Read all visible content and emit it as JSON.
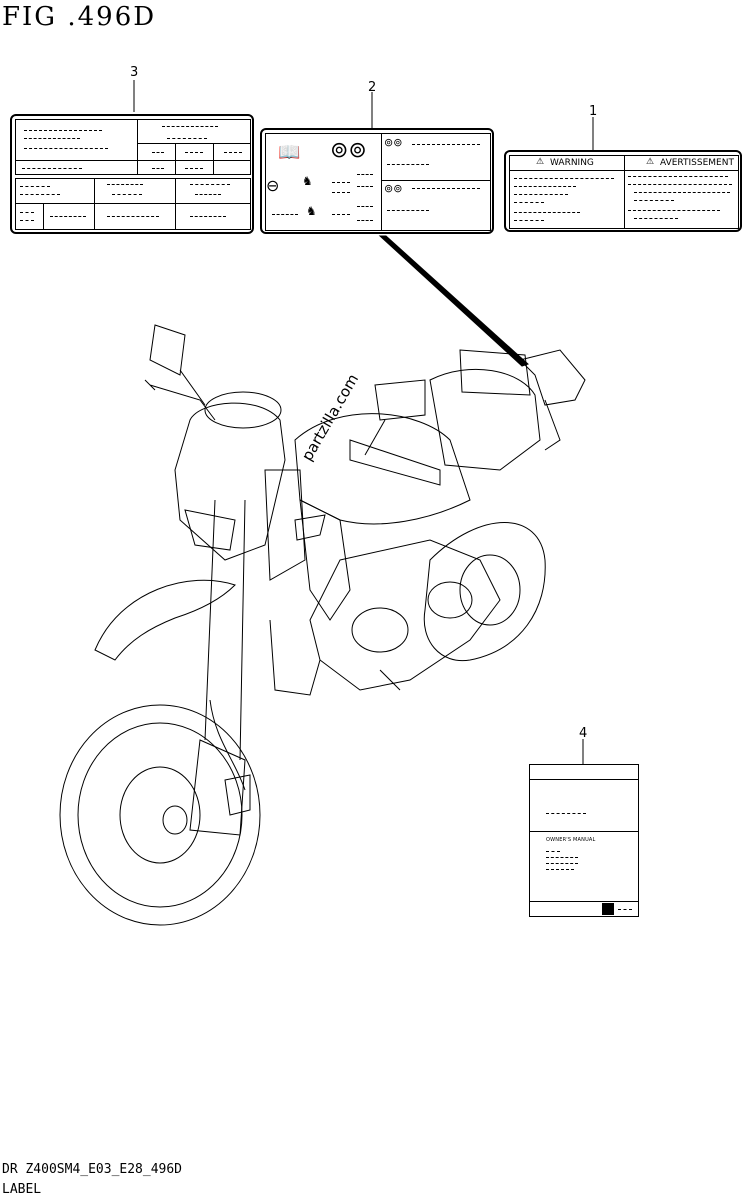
{
  "figure": {
    "title": "FIG .496D",
    "code": "DR Z400SM4_E03_E28_496D",
    "caption": "LABEL"
  },
  "callouts": {
    "label_1": "1",
    "label_2": "2",
    "label_3": "3",
    "label_4": "4"
  },
  "warning_label": {
    "warning": "WARNING",
    "avertissement": "AVERTISSEMENT"
  },
  "manual": {
    "title_text": "OWNER'S MANUAL"
  },
  "watermark": "partzilla.com"
}
